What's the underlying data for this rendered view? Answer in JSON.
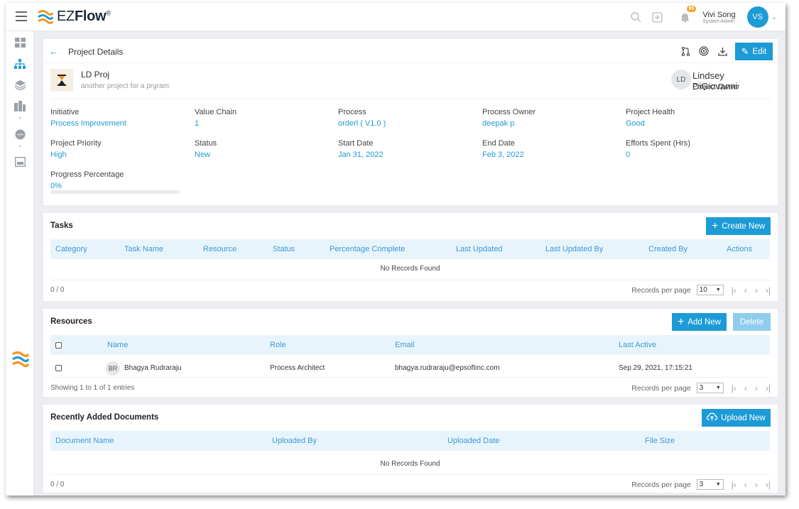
{
  "app": {
    "logo_prefix": "EZ",
    "logo_bold": "Flow",
    "logo_reg": "®",
    "notifications_count": "95",
    "user_name": "Vivi Song",
    "user_role": "System Admin",
    "user_initials": "VS"
  },
  "header": {
    "title": "Project Details",
    "edit_label": "Edit"
  },
  "project": {
    "name": "LD Proj",
    "description": "another project for a prgram",
    "owner_initials": "LD",
    "owner_name": "Lindsey DiGiovanni",
    "owner_role": "Project Owner",
    "fields": [
      {
        "label": "Initiative",
        "value": "Process Improvement"
      },
      {
        "label": "Value Chain",
        "value": "1"
      },
      {
        "label": "Process",
        "value": "orderl ( V1.0 )"
      },
      {
        "label": "Process Owner",
        "value": "deepak p"
      },
      {
        "label": "Project Health",
        "value": "Good"
      },
      {
        "label": "Project Priority",
        "value": "High"
      },
      {
        "label": "Status",
        "value": "New"
      },
      {
        "label": "Start Date",
        "value": "Jan 31, 2022"
      },
      {
        "label": "End Date",
        "value": "Feb 3, 2022"
      },
      {
        "label": "Efforts Spent (Hrs)",
        "value": "0"
      },
      {
        "label": "Progress Percentage",
        "value": "0%"
      }
    ],
    "progress_fraction": 0
  },
  "tasks": {
    "title": "Tasks",
    "create_label": "Create New",
    "columns": [
      "Category",
      "Task Name",
      "Resource",
      "Status",
      "Percentage Complete",
      "Last Updated",
      "Last Updated By",
      "Created By",
      "Actions"
    ],
    "empty_text": "No Records Found",
    "count": "0 / 0",
    "rpp_label": "Records per page",
    "rpp_value": "10"
  },
  "resources": {
    "title": "Resources",
    "add_label": "Add New",
    "delete_label": "Delete",
    "columns": [
      "Name",
      "Role",
      "Email",
      "Last Active"
    ],
    "rows": [
      {
        "initials": "BR",
        "name": "Bhagya Rudraraju",
        "role": "Process Architect",
        "email": "bhagya.rudraraju@epsoftinc.com",
        "last_active": "Sep 29, 2021, 17:15:21"
      }
    ],
    "count": "Showing 1 to 1 of 1 entries",
    "rpp_label": "Records per page",
    "rpp_value": "3"
  },
  "documents": {
    "title": "Recently Added Documents",
    "upload_label": "Upload New",
    "columns": [
      "Document Name",
      "Uploaded By",
      "Uploaded Date",
      "File Size"
    ],
    "empty_text": "No Records Found",
    "count": "0 / 0",
    "rpp_label": "Records per page",
    "rpp_value": "3"
  },
  "colors": {
    "accent": "#1d9bd6",
    "table_header_bg": "#e8f4fb",
    "page_bg": "#ebedf0"
  }
}
